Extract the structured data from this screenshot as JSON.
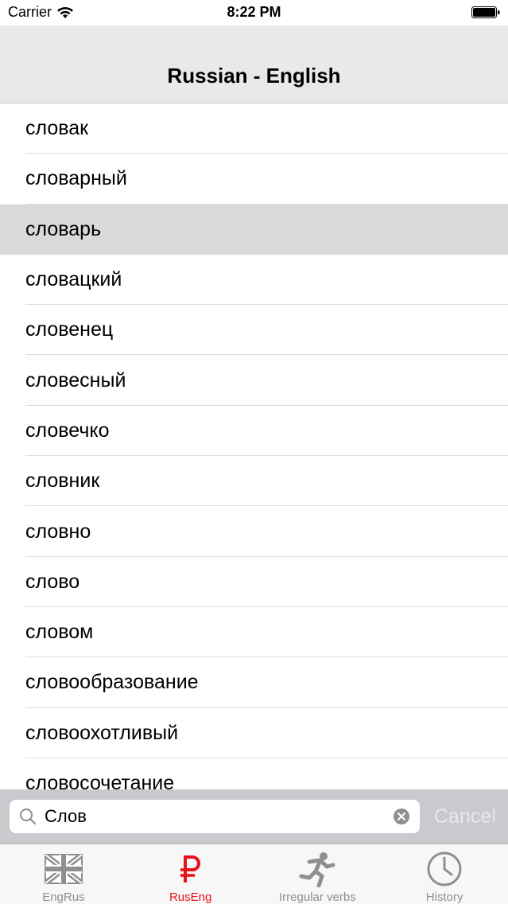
{
  "status_bar": {
    "carrier": "Carrier",
    "time": "8:22 PM"
  },
  "nav": {
    "title": "Russian - English"
  },
  "list": {
    "items": [
      {
        "label": "словак",
        "selected": false
      },
      {
        "label": "словарный",
        "selected": false
      },
      {
        "label": "словарь",
        "selected": true
      },
      {
        "label": "словацкий",
        "selected": false
      },
      {
        "label": "словенец",
        "selected": false
      },
      {
        "label": "словесный",
        "selected": false
      },
      {
        "label": "словечко",
        "selected": false
      },
      {
        "label": "словник",
        "selected": false
      },
      {
        "label": "словно",
        "selected": false
      },
      {
        "label": "слово",
        "selected": false
      },
      {
        "label": "словом",
        "selected": false
      },
      {
        "label": "словообразование",
        "selected": false
      },
      {
        "label": "словоохотливый",
        "selected": false
      },
      {
        "label": "словосочетание",
        "selected": false
      }
    ]
  },
  "search": {
    "value": "Слов",
    "cancel_label": "Cancel"
  },
  "tabs": [
    {
      "label": "EngRus",
      "icon": "uk-flag-icon",
      "active": false
    },
    {
      "label": "RusEng",
      "icon": "ruble-icon",
      "active": true
    },
    {
      "label": "Irregular verbs",
      "icon": "running-man-icon",
      "active": false
    },
    {
      "label": "History",
      "icon": "clock-icon",
      "active": false
    }
  ],
  "colors": {
    "accent": "#e8101a",
    "nav_background": "#e9e9ea",
    "selected_row": "#d9d9db",
    "search_bar_background": "#c9c9ce",
    "tab_inactive": "#8e8e93"
  }
}
